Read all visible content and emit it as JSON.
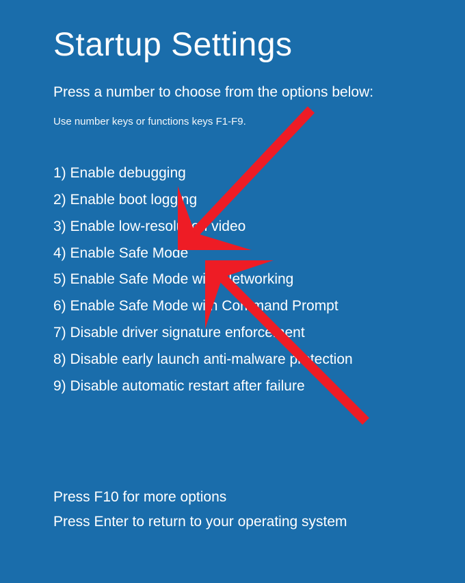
{
  "title": "Startup Settings",
  "subtitle": "Press a number to choose from the options below:",
  "hint": "Use number keys or functions keys F1-F9.",
  "options": [
    "1) Enable debugging",
    "2) Enable boot logging",
    "3) Enable low-resolution video",
    "4) Enable Safe Mode",
    "5) Enable Safe Mode with Networking",
    "6) Enable Safe Mode with Command Prompt",
    "7) Disable driver signature enforcement",
    "8) Disable early launch anti-malware protection",
    "9) Disable automatic restart after failure"
  ],
  "footer": {
    "more": "Press F10 for more options",
    "return": "Press Enter to return to your operating system"
  },
  "annotation": {
    "arrow_color": "#ee1c25"
  }
}
